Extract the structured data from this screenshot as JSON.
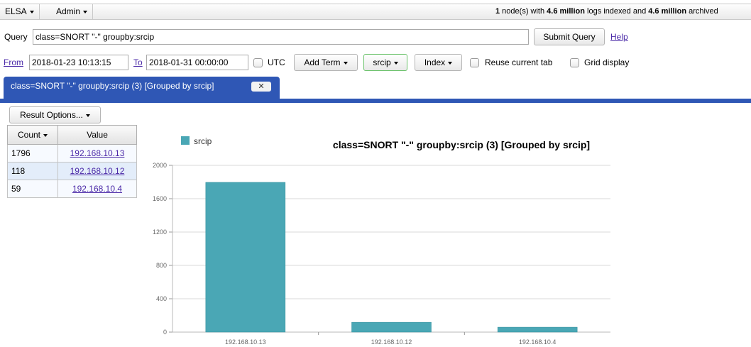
{
  "menus": {
    "elsa": "ELSA",
    "admin": "Admin"
  },
  "status": {
    "nodes": "1",
    "nodes_text": " node(s) with ",
    "logs": "4.6 million",
    "logs_text": " logs indexed and ",
    "archived": "4.6 million",
    "archived_text": " archived"
  },
  "query": {
    "label": "Query",
    "value": "class=SNORT \"-\" groupby:srcip",
    "submit": "Submit Query",
    "help": "Help"
  },
  "range": {
    "from_label": "From",
    "from_value": "2018-01-23 10:13:15",
    "to_label": "To",
    "to_value": "2018-01-31 00:00:00",
    "utc": "UTC",
    "add_term": "Add Term",
    "groupby": "srcip",
    "index": "Index",
    "reuse_tab": "Reuse current tab",
    "grid_display": "Grid display"
  },
  "tab": {
    "label": "class=SNORT \"-\" groupby:srcip (3) [Grouped by srcip]",
    "close": "✕"
  },
  "result_options": "Result Options...",
  "table": {
    "headers": {
      "count": "Count",
      "value": "Value"
    },
    "rows": [
      {
        "count": "1796",
        "value": "192.168.10.13"
      },
      {
        "count": "118",
        "value": "192.168.10.12"
      },
      {
        "count": "59",
        "value": "192.168.10.4"
      }
    ]
  },
  "colors": {
    "bar": "#4aa7b5",
    "tab": "#2f57b5",
    "link": "#4b2aa8"
  },
  "chart_data": {
    "type": "bar",
    "title": "class=SNORT \"-\" groupby:srcip (3) [Grouped by srcip]",
    "categories": [
      "192.168.10.13",
      "192.168.10.12",
      "192.168.10.4"
    ],
    "series": [
      {
        "name": "srcip",
        "values": [
          1796,
          118,
          59
        ]
      }
    ],
    "yticks": [
      0,
      400,
      800,
      1200,
      1600,
      2000
    ],
    "ylim": [
      0,
      2000
    ],
    "xlabel": "",
    "ylabel": "",
    "legend": "top-left",
    "grid": true
  }
}
